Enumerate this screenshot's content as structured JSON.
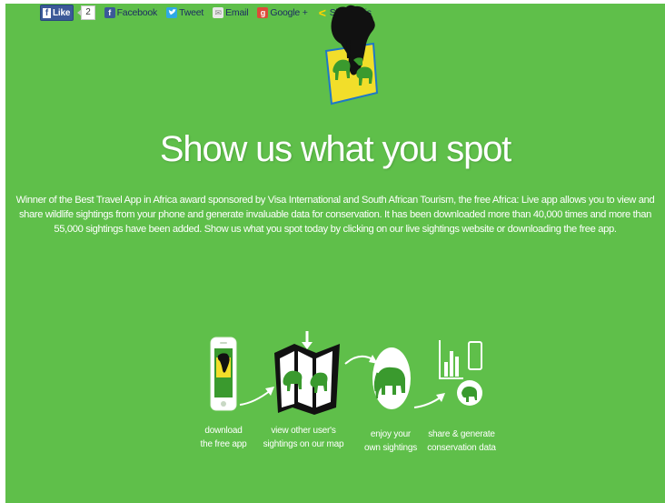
{
  "share_bar": {
    "like_label": "Like",
    "like_count": "2",
    "items": [
      {
        "label": "Facebook",
        "icon": "facebook-icon"
      },
      {
        "label": "Tweet",
        "icon": "twitter-icon"
      },
      {
        "label": "Email",
        "icon": "email-icon"
      },
      {
        "label": "Google +",
        "icon": "google-plus-icon"
      },
      {
        "label": "ShareThis",
        "icon": "sharethis-icon"
      }
    ]
  },
  "heading": "Show us what you spot",
  "description": "Winner of the Best Travel App in Africa award sponsored by Visa International and South African Tourism, the free Africa: Live app allows you to view and share wildlife sightings from your phone and generate invaluable data for conservation. It has been downloaded more than 40,000 times and more than 55,000 sightings have been added. Show us what you spot today by clicking on our live sightings website or downloading the free app.",
  "steps": [
    {
      "line1": "download",
      "line2": "the free app",
      "icon": "phone-app-icon"
    },
    {
      "line1": "view other user's",
      "line2": "sightings on our map",
      "icon": "map-icon"
    },
    {
      "line1": "enjoy your",
      "line2": "own sightings",
      "icon": "elephant-icon"
    },
    {
      "line1": "share & generate",
      "line2": "conservation data",
      "icon": "data-share-icon"
    }
  ],
  "colors": {
    "background": "#5fbf4a",
    "text": "#ffffff"
  }
}
